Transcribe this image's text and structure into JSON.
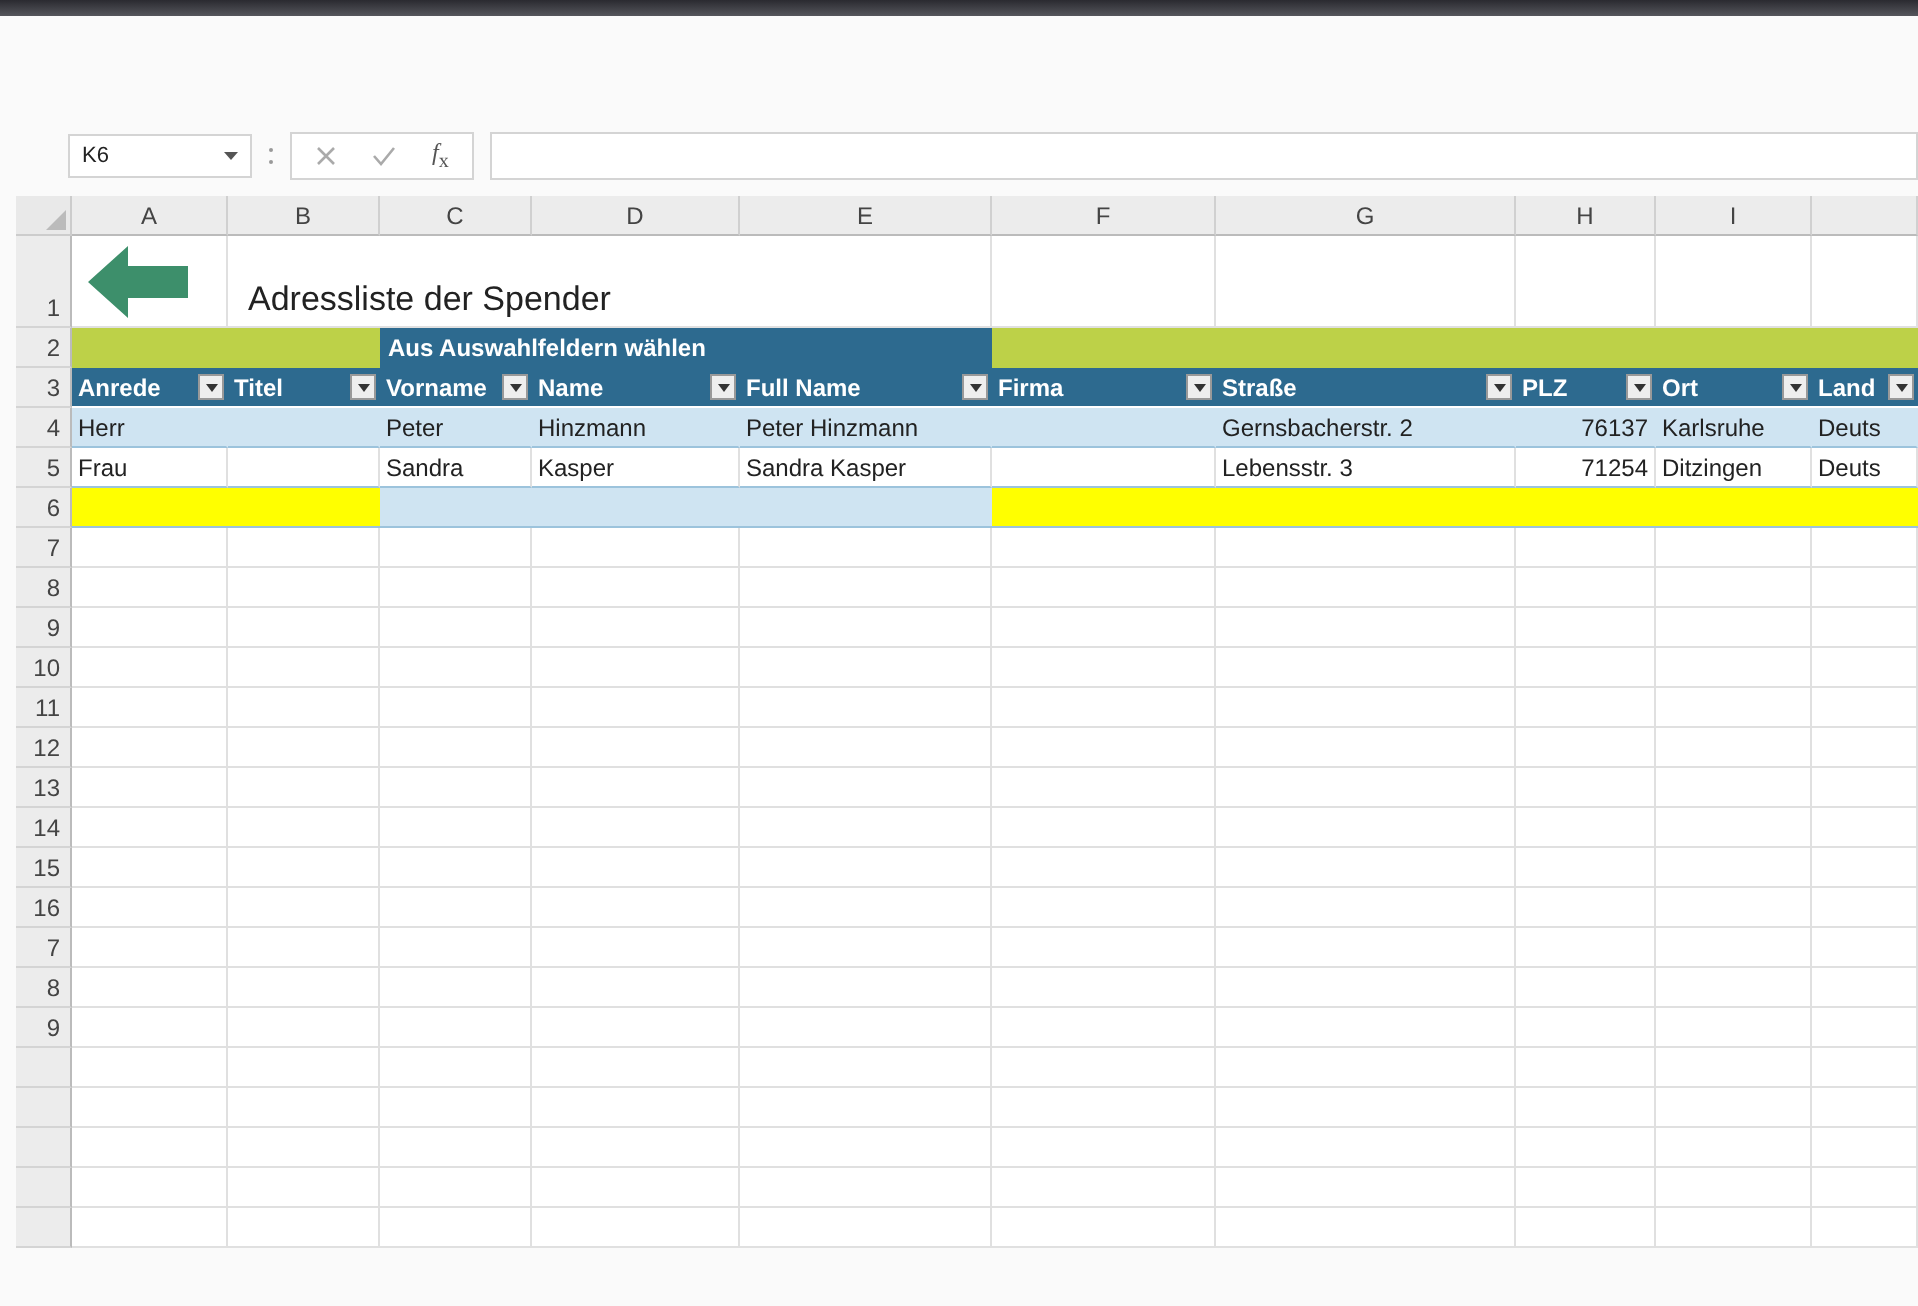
{
  "formula_bar": {
    "name_box": "K6",
    "function_label": "*f*$_{x}$"
  },
  "column_headers": [
    "A",
    "B",
    "C",
    "D",
    "E",
    "F",
    "G",
    "H",
    "I"
  ],
  "row_headers": [
    "1",
    "2",
    "3",
    "4",
    "5",
    "6",
    "7",
    "8",
    "9",
    "10",
    "11",
    "12",
    "13",
    "14",
    "15",
    "16",
    "7",
    "8",
    "9"
  ],
  "title": "Adressliste der Spender",
  "band_label": "Aus Auswahlfeldern wählen",
  "table": {
    "columns": [
      {
        "label": "Anrede"
      },
      {
        "label": "Titel"
      },
      {
        "label": "Vorname"
      },
      {
        "label": "Name"
      },
      {
        "label": "Full Name"
      },
      {
        "label": "Firma"
      },
      {
        "label": "Straße"
      },
      {
        "label": "PLZ"
      },
      {
        "label": "Ort"
      },
      {
        "label": "Land"
      }
    ],
    "rows": [
      {
        "cells": [
          {
            "text": "Herr",
            "kind": "text"
          },
          null,
          {
            "text": "Peter",
            "kind": "text"
          },
          {
            "text": "Hinzmann",
            "kind": "text"
          },
          {
            "text": "Peter Hinzmann",
            "kind": "text"
          },
          null,
          {
            "text": "Gernsbacherstr. 2",
            "kind": "text"
          },
          {
            "text": "76137",
            "kind": "number"
          },
          {
            "text": "Karlsruhe",
            "kind": "text"
          },
          {
            "text": "Deuts",
            "kind": "text"
          }
        ]
      },
      {
        "cells": [
          {
            "text": "Frau",
            "kind": "text"
          },
          null,
          {
            "text": "Sandra",
            "kind": "text"
          },
          {
            "text": "Kasper",
            "kind": "text"
          },
          {
            "text": "Sandra Kasper",
            "kind": "text"
          },
          null,
          {
            "text": "Lebensstr. 3",
            "kind": "text"
          },
          {
            "text": "71254",
            "kind": "number"
          },
          {
            "text": "Ditzingen",
            "kind": "text"
          },
          {
            "text": "Deuts",
            "kind": "text"
          }
        ]
      }
    ]
  }
}
